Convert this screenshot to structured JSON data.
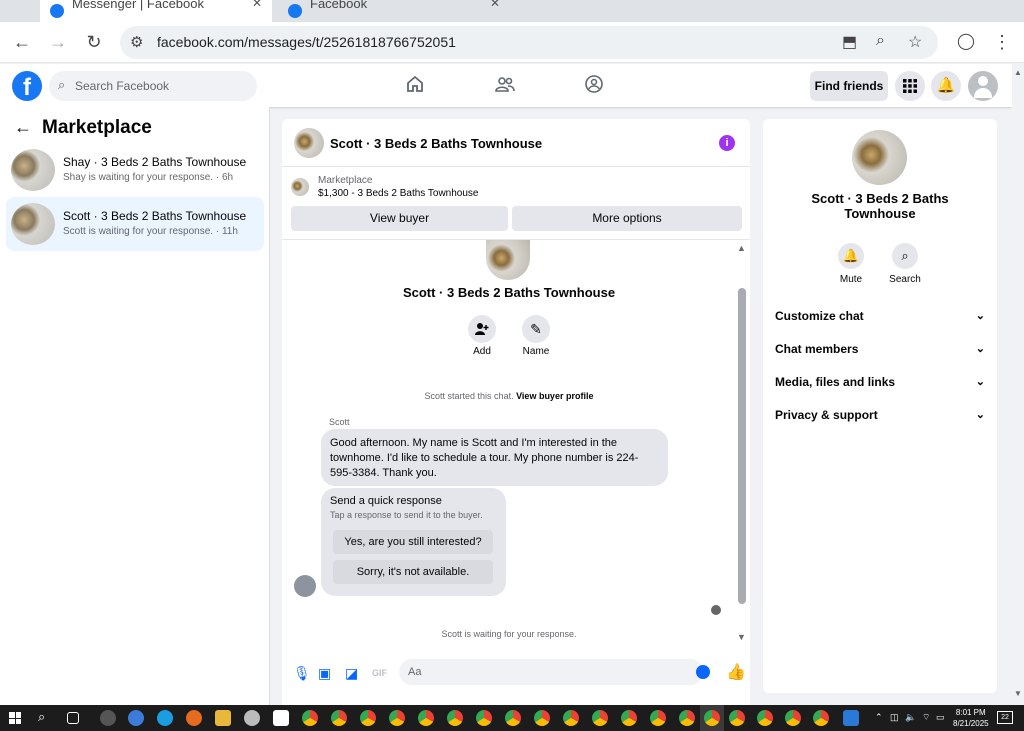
{
  "browser": {
    "tabs": [
      {
        "title": "Messenger | Facebook"
      },
      {
        "title": "Facebook"
      }
    ],
    "url": "facebook.com/messages/t/25261818766752051"
  },
  "header": {
    "search_placeholder": "Search Facebook",
    "find_friends_label": "Find friends"
  },
  "left_panel": {
    "title": "Marketplace",
    "conversations": [
      {
        "title": "Shay · 3 Beds 2 Baths Townhouse",
        "subtitle": "Shay is waiting for your response. · 6h"
      },
      {
        "title": "Scott · 3 Beds 2 Baths Townhouse",
        "subtitle": "Scott is waiting for your response. · 11h"
      }
    ]
  },
  "chat": {
    "title": "Scott · 3 Beds 2 Baths Townhouse",
    "marketplace_label": "Marketplace",
    "listing_price": "$1,300 - 3 Beds 2 Baths Townhouse",
    "view_buyer_label": "View buyer",
    "more_options_label": "More options",
    "profile_name": "Scott · 3 Beds 2 Baths Townhouse",
    "add_label": "Add",
    "name_label": "Name",
    "started_text": "Scott started this chat.",
    "view_buyer_profile_label": "View buyer profile",
    "sender": "Scott",
    "message": "Good afternoon. My name is Scott and I'm interested in the townhome. I'd like to schedule a tour. My phone number is 224-595-3384. Thank you.",
    "quick_title": "Send a quick response",
    "quick_subtitle": "Tap a response to send it to the buyer.",
    "quick_options": [
      "Yes, are you still interested?",
      "Sorry, it's not available."
    ],
    "waiting_text": "Scott is waiting for your response.",
    "input_placeholder": "Aa"
  },
  "right_panel": {
    "name": "Scott · 3 Beds 2 Baths Townhouse",
    "mute_label": "Mute",
    "search_label": "Search",
    "sections": [
      "Customize chat",
      "Chat members",
      "Media, files and links",
      "Privacy & support"
    ]
  },
  "taskbar": {
    "time": "8:01 PM",
    "date": "8/21/2025",
    "notifications": "22"
  },
  "colors": {
    "fb_blue": "#1877f2",
    "messenger_blue": "#0866ff",
    "info_purple": "#a033f0",
    "selected_row": "#ebf5ff"
  }
}
